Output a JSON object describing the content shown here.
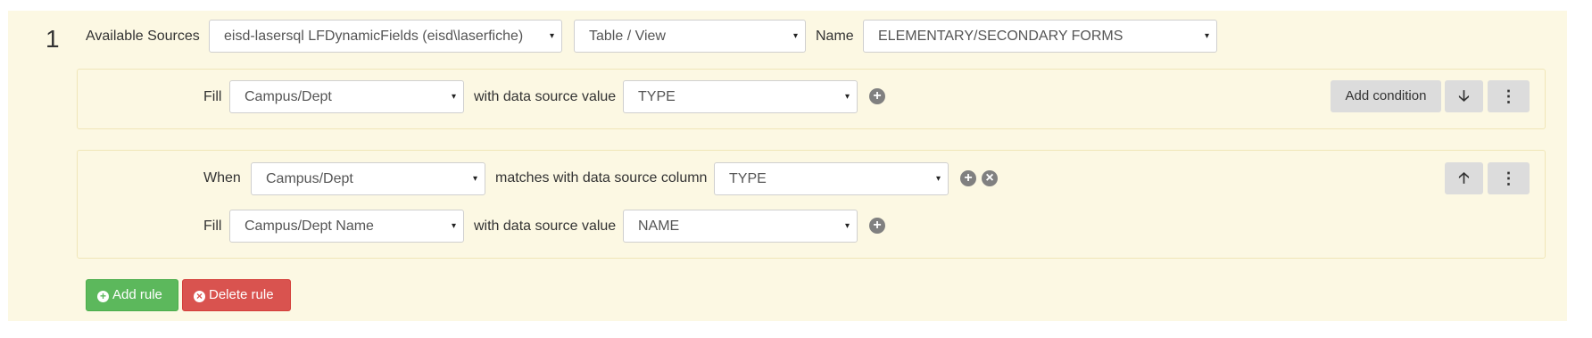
{
  "rule": {
    "number": "1",
    "available_sources_label": "Available Sources",
    "source_value": "eisd-lasersql LFDynamicFields (eisd\\laserfiche)",
    "type_value": "Table / View",
    "name_label": "Name",
    "name_value": "ELEMENTARY/SECONDARY FORMS"
  },
  "fill_block": {
    "fill_label": "Fill",
    "field_value": "Campus/Dept",
    "with_label": "with data source value",
    "column_value": "TYPE",
    "add_condition_label": "Add condition"
  },
  "condition_block": {
    "when_label": "When",
    "when_field_value": "Campus/Dept",
    "matches_label": "matches with data source column",
    "matches_column_value": "TYPE",
    "fill_label": "Fill",
    "fill_field_value": "Campus/Dept Name",
    "with_label": "with data source value",
    "fill_column_value": "NAME"
  },
  "footer": {
    "add_rule_label": "Add rule",
    "delete_rule_label": "Delete rule"
  },
  "icons": {
    "caret": "▾",
    "plus": "+",
    "close": "×",
    "arrow_down": "🡣",
    "arrow_up": "🡡",
    "kebab": "⋮"
  },
  "colors": {
    "panel_bg": "#fcf8e3",
    "add_rule_green": "#5cb85c",
    "delete_rule_red": "#d9534f",
    "gray_button": "#dcdcdc"
  }
}
